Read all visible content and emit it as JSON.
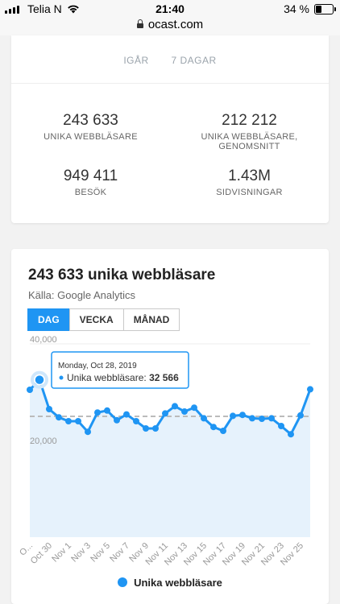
{
  "status": {
    "carrier": "Telia N",
    "time": "21:40",
    "battery": "34 %",
    "battery_level": 0.34
  },
  "browser": {
    "url": "ocast.com"
  },
  "stats_card": {
    "tabs": [
      "IGÅR",
      "7 DAGAR"
    ],
    "stats": [
      {
        "value": "243 633",
        "label": "UNIKA WEBBLÄSARE"
      },
      {
        "value": "212 212",
        "label": "UNIKA WEBBLÄSARE, GENOMSNITT"
      },
      {
        "value": "949 411",
        "label": "BESÖK"
      },
      {
        "value": "1.43M",
        "label": "SIDVISNINGAR"
      }
    ]
  },
  "chart_card": {
    "title": "243 633 unika webbläsare",
    "source": "Källa: Google Analytics",
    "period_buttons": [
      "DAG",
      "VECKA",
      "MÅNAD"
    ],
    "tooltip": {
      "date": "Monday, Oct 28, 2019",
      "series": "Unika webbläsare",
      "value": "32 566"
    }
  },
  "colors": {
    "accent": "#1f95f3",
    "area": "#e6f2fc",
    "average_line": "#bbbbbb"
  },
  "chart_data": {
    "type": "line",
    "x": [
      "Oct 27",
      "Oct 28",
      "Oct 29",
      "Oct 30",
      "Oct 31",
      "Nov 1",
      "Nov 2",
      "Nov 3",
      "Nov 4",
      "Nov 5",
      "Nov 6",
      "Nov 7",
      "Nov 8",
      "Nov 9",
      "Nov 10",
      "Nov 11",
      "Nov 12",
      "Nov 13",
      "Nov 14",
      "Nov 15",
      "Nov 16",
      "Nov 17",
      "Nov 18",
      "Nov 19",
      "Nov 20",
      "Nov 21",
      "Nov 22",
      "Nov 23",
      "Nov 24",
      "Nov 25"
    ],
    "x_tick_labels": [
      "O...",
      "Oct 30",
      "Nov 1",
      "Nov 3",
      "Nov 5",
      "Nov 7",
      "Nov 9",
      "Nov 11",
      "Nov 13",
      "Nov 15",
      "Nov 17",
      "Nov 19",
      "Nov 21",
      "Nov 23",
      "Nov 25"
    ],
    "series": [
      {
        "name": "Unika webbläsare",
        "values": [
          30500,
          32566,
          26500,
          24800,
          24000,
          24000,
          21800,
          25800,
          26200,
          24200,
          25400,
          24000,
          22500,
          22500,
          25600,
          27100,
          26000,
          26800,
          24600,
          22800,
          22000,
          25100,
          25300,
          24600,
          24500,
          24600,
          23000,
          21300,
          25200,
          30600
        ]
      }
    ],
    "average": 25000,
    "y_ticks": [
      "20,000",
      "40,000"
    ],
    "ylim": [
      0,
      40000
    ],
    "legend": "bottom-center",
    "grid": false
  }
}
